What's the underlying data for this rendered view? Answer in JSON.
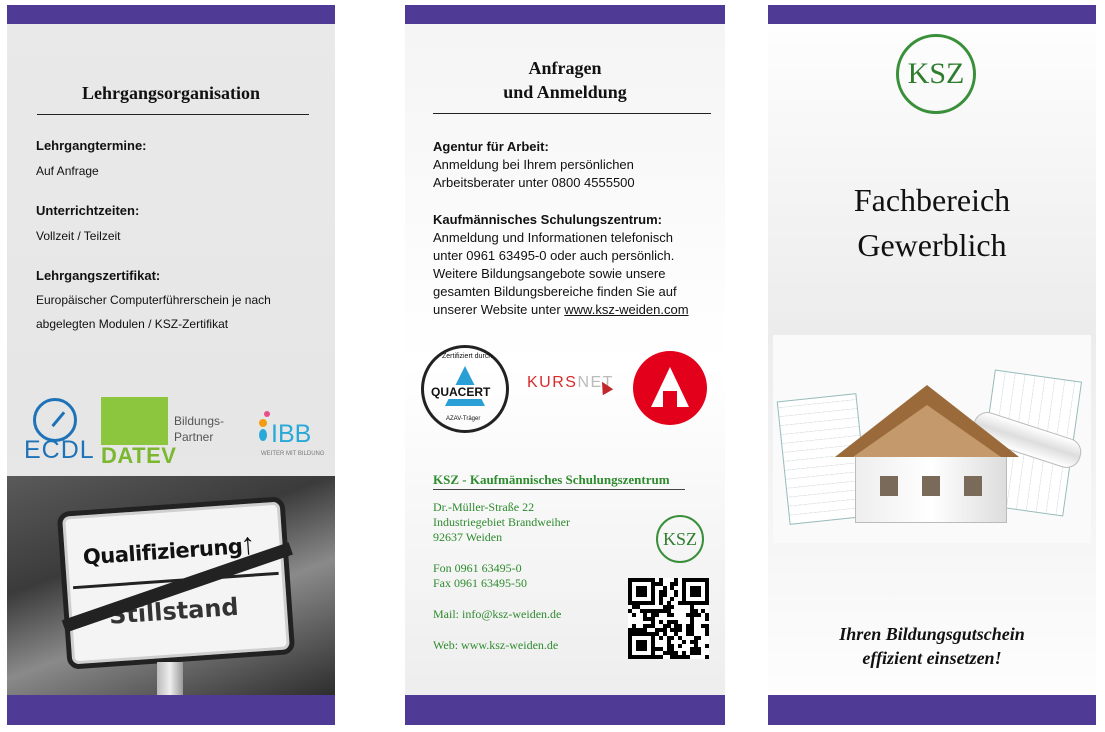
{
  "panel1": {
    "heading": "Lehrgangsorganisation",
    "items": [
      {
        "label": "Lehrgangtermine:",
        "value": "Auf Anfrage"
      },
      {
        "label": "Unterrichtzeiten:",
        "value": "Vollzeit / Teilzeit"
      },
      {
        "label": "Lehrgangszertifikat:",
        "value_line1": "Europäischer Computerführerschein je nach",
        "value_line2": "abgelegten Modulen / KSZ-Zertifikat"
      }
    ],
    "logos": {
      "ecdl": "ECDL",
      "datev": "DATEV",
      "partner_line1": "Bildungs-",
      "partner_line2": "Partner",
      "ibb": "IBB",
      "ibb_tagline": "WEITER MIT BILDUNG"
    },
    "sign": {
      "top": "Qualifizierung",
      "arrow": "↑",
      "bottom": "Stillstand"
    }
  },
  "panel2": {
    "heading_line1": "Anfragen",
    "heading_line2": "und Anmeldung",
    "agentur": {
      "title": "Agentur für Arbeit:",
      "line1": "Anmeldung bei Ihrem persönlichen",
      "line2": "Arbeitsberater unter 0800 4555500"
    },
    "ksz": {
      "title": "Kaufmännisches Schulungszentrum:",
      "line1": "Anmeldung und Informationen telefonisch",
      "line2": "unter 0961 63495-0 oder auch persönlich.",
      "line3": "Weitere Bildungsangebote sowie unsere",
      "line4": "gesamten Bildungsbereiche finden Sie auf",
      "line5_prefix": "unserer Website unter ",
      "line5_link": "www.ksz-weiden.com"
    },
    "logos": {
      "quacert": "QUACERT",
      "quacert_top": "Zertifiziert durch",
      "quacert_bottom": "AZAV-Träger",
      "kursnet_red": "KURS",
      "kursnet_grey": "NET"
    },
    "contact": {
      "org": "KSZ - Kaufmännisches Schulungszentrum",
      "street": "Dr.-Müller-Straße 22",
      "area": "Industriegebiet Brandweiher",
      "city": "92637 Weiden",
      "fon": "Fon 0961 63495-0",
      "fax": "Fax 0961 63495-50",
      "mail": "Mail: info@ksz-weiden.de",
      "web": "Web: www.ksz-weiden.de"
    },
    "ksz_logo": "KSZ"
  },
  "panel3": {
    "ksz_logo": "KSZ",
    "title_line1": "Fachbereich",
    "title_line2": "Gewerblich",
    "slogan_line1": "Ihren Bildungsgutschein",
    "slogan_line2": "effizient einsetzen!"
  },
  "colors": {
    "band": "#4f3a96",
    "ksz_green": "#2e8b2e",
    "ecdl_blue": "#1e72b8",
    "datev_green": "#8cc63f",
    "ibb_blue": "#29a9d8",
    "arbeitsagentur_red": "#e2001a"
  }
}
